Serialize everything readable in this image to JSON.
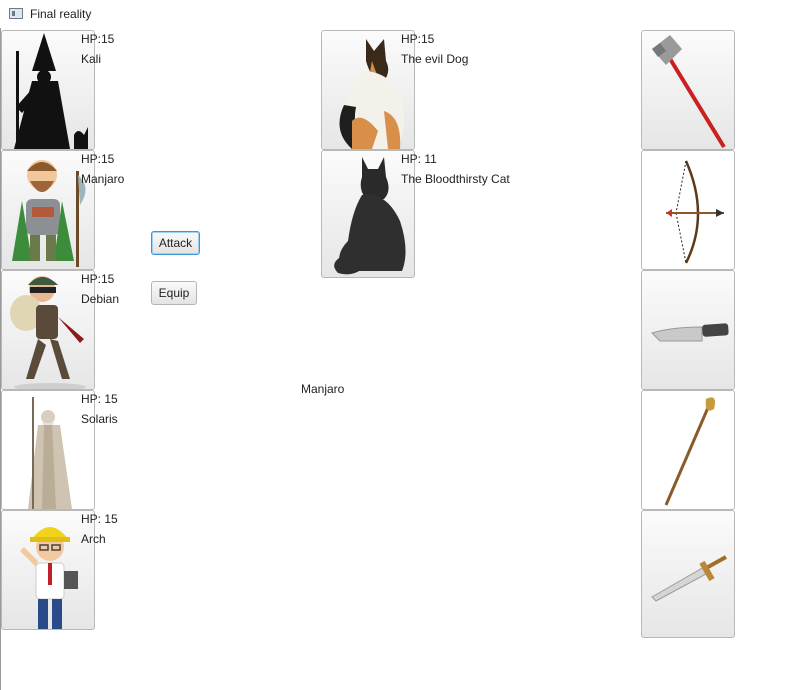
{
  "window": {
    "title": "Final reality"
  },
  "party": [
    {
      "hp": "HP:15",
      "name": "Kali",
      "icon": "dark-wizard-icon"
    },
    {
      "hp": "HP:15",
      "name": "Manjaro",
      "icon": "armored-dwarf-icon"
    },
    {
      "hp": "HP:15",
      "name": "Debian",
      "icon": "thief-icon"
    },
    {
      "hp": "HP: 15",
      "name": "Solaris",
      "icon": "white-wizard-icon"
    },
    {
      "hp": "HP: 15",
      "name": "Arch",
      "icon": "engineer-icon"
    }
  ],
  "enemies": [
    {
      "hp": "HP:15",
      "name": "The evil Dog",
      "icon": "dog-icon"
    },
    {
      "hp": "HP: 11",
      "name": "The Bloodthirsty Cat",
      "icon": "cat-icon"
    }
  ],
  "actions": {
    "attack_label": "Attack",
    "equip_label": "Equip"
  },
  "selected_character": "Manjaro",
  "weapons": [
    {
      "icon": "axe-icon"
    },
    {
      "icon": "bow-icon"
    },
    {
      "icon": "knife-icon"
    },
    {
      "icon": "staff-icon"
    },
    {
      "icon": "sword-icon"
    }
  ]
}
